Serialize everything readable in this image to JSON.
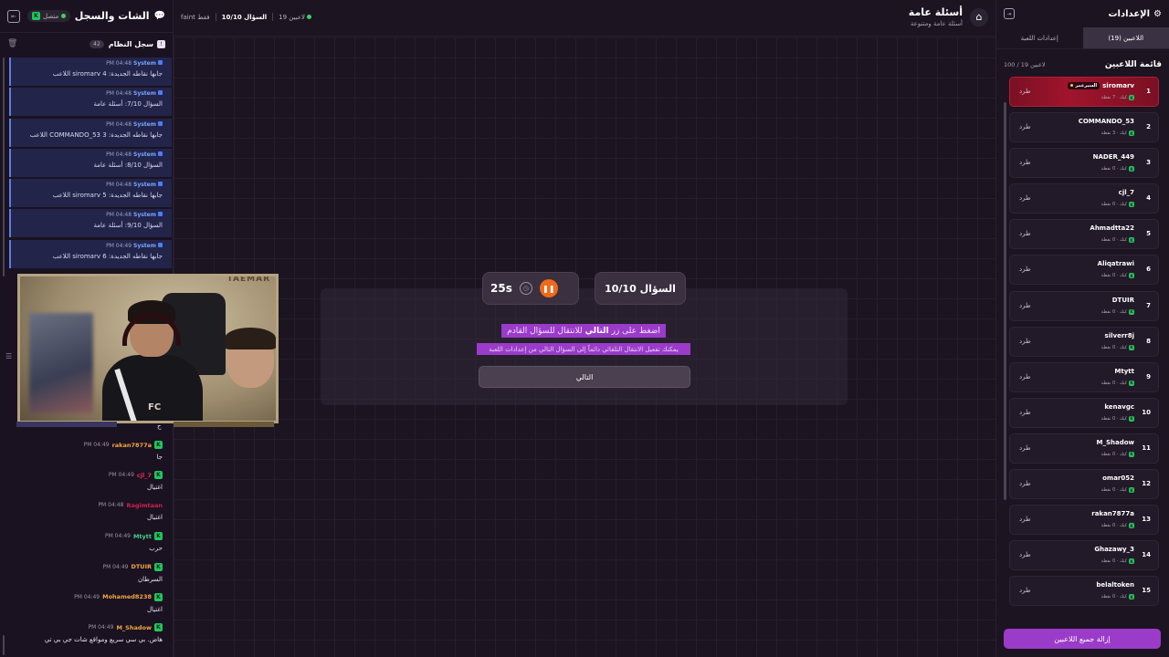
{
  "chat": {
    "title": "الشات والسجل",
    "status": "متصل",
    "system_log_title": "سجل النظام",
    "system_log_count": "42",
    "system_messages": [
      {
        "sender": "System",
        "time": "PM 04:48",
        "text": "اللاعب siromarv جابها نقاطه الجديدة: 4"
      },
      {
        "sender": "System",
        "time": "PM 04:48",
        "text": "السؤال 7/10: أسئلة عامة"
      },
      {
        "sender": "System",
        "time": "PM 04:48",
        "text": "اللاعب COMMANDO_53 جابها نقاطه الجديدة: 3"
      },
      {
        "sender": "System",
        "time": "PM 04:48",
        "text": "السؤال 8/10: أسئلة عامة"
      },
      {
        "sender": "System",
        "time": "PM 04:48",
        "text": "اللاعب siromarv جابها نقاطه الجديدة: 5"
      },
      {
        "sender": "System",
        "time": "PM 04:48",
        "text": "السؤال 9/10: أسئلة عامة"
      },
      {
        "sender": "System",
        "time": "PM 04:49",
        "text": "اللاعب siromarv جابها نقاطه الجديدة: 6"
      }
    ],
    "first_visible_text": "ح",
    "messages": [
      {
        "user": "rakan7877a",
        "color": "#f0a640",
        "time": "PM 04:49",
        "text": "جا"
      },
      {
        "user": "cjl_7",
        "color": "#e0305a",
        "time": "PM 04:49",
        "text": "اغتيال"
      },
      {
        "user": "Ragimtaan",
        "color": "#d02050",
        "time": "PM 04:48",
        "text": "اغتيال"
      },
      {
        "user": "Mtytt",
        "color": "#3fd18a",
        "time": "PM 04:49",
        "text": "حرب"
      },
      {
        "user": "DTUIR",
        "color": "#f0a640",
        "time": "PM 04:49",
        "text": "السرطان"
      },
      {
        "user": "Mohamed8238",
        "color": "#f0a640",
        "time": "PM 04:49",
        "text": "اغتيال"
      },
      {
        "user": "M_Shadow",
        "color": "#f0a640",
        "time": "PM 04:49",
        "text": "هاض. بي سي سريع ومواقع شات جي بي تي"
      }
    ]
  },
  "webcam": {
    "tag": "TAEMAR"
  },
  "topbar": {
    "category_title": "أسئلة عامة",
    "category_subtitle": "أسئلة عامة ومتنوعة",
    "question_progress": "السؤال 10/10",
    "players_online": "19 لاعبين",
    "owner_only": "faint فقط"
  },
  "question": {
    "label": "السؤال 10/10",
    "timer": "25s",
    "instruction_prefix": "اضغط على زر",
    "instruction_bold": "التالي",
    "instruction_suffix": "للانتقال للسؤال القادم",
    "instruction_sub": "يمكنك تفعيل الانتقال التلقائي دائماً إلى السؤال التالي من إعدادات اللعبة",
    "next_button": "التالي"
  },
  "settings": {
    "title": "الإعدادات",
    "tabs": [
      "اللاعبين (19)",
      "إعدادات اللعبة"
    ],
    "players_title": "قائمة اللاعبين",
    "players_count": "100 / 19 لاعبين",
    "kick_label": "طرد",
    "remove_all": "إزالة جميع اللاعبين",
    "players": [
      {
        "rank": "1",
        "name": "siromarv",
        "badge": "السيرعمر",
        "sub": "كيك · 7 نقطة"
      },
      {
        "rank": "2",
        "name": "COMMANDO_53",
        "badge": "",
        "sub": "كيك · 3 نقطة"
      },
      {
        "rank": "3",
        "name": "NADER_449",
        "badge": "",
        "sub": "كيك · 0 نقطة"
      },
      {
        "rank": "4",
        "name": "cjl_7",
        "badge": "",
        "sub": "كيك · 0 نقطة"
      },
      {
        "rank": "5",
        "name": "Ahmadtta22",
        "badge": "",
        "sub": "كيك · 0 نقطة"
      },
      {
        "rank": "6",
        "name": "Aliqatrawi",
        "badge": "",
        "sub": "كيك · 0 نقطة"
      },
      {
        "rank": "7",
        "name": "DTUIR",
        "badge": "",
        "sub": "كيك · 0 نقطة"
      },
      {
        "rank": "8",
        "name": "silverr8j",
        "badge": "",
        "sub": "كيك · 0 نقطة"
      },
      {
        "rank": "9",
        "name": "Mtytt",
        "badge": "",
        "sub": "كيك · 0 نقطة"
      },
      {
        "rank": "10",
        "name": "kenavgc",
        "badge": "",
        "sub": "كيك · 0 نقطة"
      },
      {
        "rank": "11",
        "name": "M_Shadow",
        "badge": "",
        "sub": "كيك · 0 نقطة"
      },
      {
        "rank": "12",
        "name": "omar052",
        "badge": "",
        "sub": "كيك · 0 نقطة"
      },
      {
        "rank": "13",
        "name": "rakan7877a",
        "badge": "",
        "sub": "كيك · 0 نقطة"
      },
      {
        "rank": "14",
        "name": "Ghazawy_3",
        "badge": "",
        "sub": "كيك · 0 نقطة"
      },
      {
        "rank": "15",
        "name": "belaltoken",
        "badge": "",
        "sub": "كيك · 0 نقطة"
      }
    ]
  },
  "colors": {
    "accent": "#9b3bc9",
    "first_place": "#a0142c",
    "pause": "#ef6a1a",
    "online": "#3ecf6a"
  }
}
